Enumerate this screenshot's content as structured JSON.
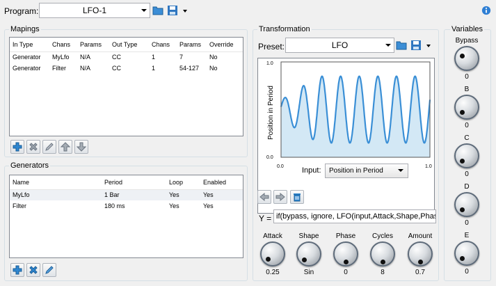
{
  "program": {
    "label": "Program:",
    "value": "LFO-1"
  },
  "mappings": {
    "title": "Mapings",
    "columns": [
      "In Type",
      "Chans",
      "Params",
      "Out Type",
      "Chans",
      "Params",
      "Override"
    ],
    "rows": [
      [
        "Generator",
        "MyLfo",
        "N/A",
        "CC",
        "1",
        "7",
        "No"
      ],
      [
        "Generator",
        "Filter",
        "N/A",
        "CC",
        "1",
        "54-127",
        "No"
      ]
    ]
  },
  "generators": {
    "title": "Generators",
    "columns": [
      "Name",
      "Period",
      "Loop",
      "Enabled"
    ],
    "rows": [
      [
        "MyLfo",
        "1 Bar",
        "Yes",
        "Yes"
      ],
      [
        "Filter",
        "180 ms",
        "Yes",
        "Yes"
      ]
    ]
  },
  "transformation": {
    "title": "Transformation",
    "preset_label": "Preset:",
    "preset_value": "LFO",
    "input_label": "Input:",
    "input_value": "Position in Period",
    "formula_label": "Y =",
    "formula": "if(bypass, ignore, LFO(input,Attack,Shape,Phase"
  },
  "knobs": [
    {
      "name": "Attack",
      "value": "0.25"
    },
    {
      "name": "Shape",
      "value": "Sin"
    },
    {
      "name": "Phase",
      "value": "0"
    },
    {
      "name": "Cycles",
      "value": "8"
    },
    {
      "name": "Amount",
      "value": "0.7"
    }
  ],
  "variables": {
    "title": "Variables",
    "items": [
      {
        "name": "Bypass",
        "value": "0"
      },
      {
        "name": "B",
        "value": "0"
      },
      {
        "name": "C",
        "value": "0"
      },
      {
        "name": "D",
        "value": "0"
      },
      {
        "name": "E",
        "value": "0"
      }
    ]
  },
  "chart_data": {
    "type": "area",
    "ylabel": "Position in Period",
    "xlim": [
      0,
      1
    ],
    "ylim": [
      0,
      1
    ],
    "x_ticks": [
      "0.0",
      "1.0"
    ],
    "y_ticks": [
      "0.0",
      "1.0"
    ],
    "attack": 0.25,
    "cycles": 8,
    "amount": 0.7,
    "colors": {
      "line": "#3a8fd6",
      "fill": "#d3e8f5"
    }
  }
}
